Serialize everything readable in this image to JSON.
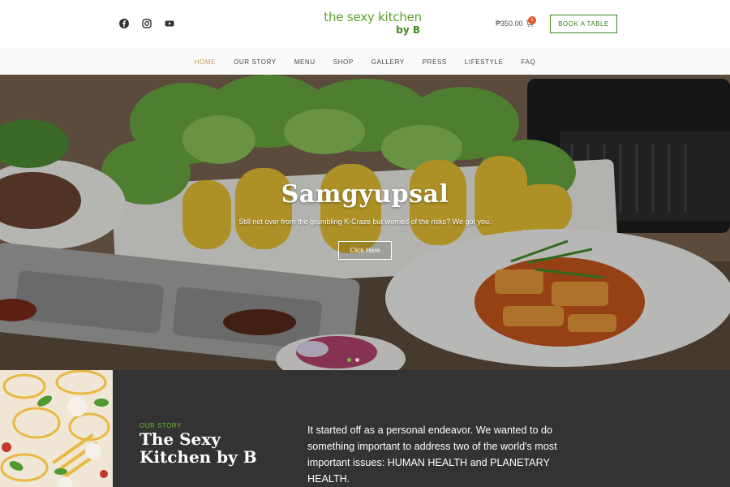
{
  "header": {
    "social": [
      "facebook-icon",
      "instagram-icon",
      "youtube-icon"
    ],
    "logo_line1": "the sexy kitchen",
    "logo_line2": "by B",
    "cart_total": "₱350.00",
    "cart_count": "1",
    "book_button": "BOOK A TABLE"
  },
  "nav": {
    "items": [
      "HOME",
      "OUR STORY",
      "MENU",
      "SHOP",
      "GALLERY",
      "PRESS",
      "LIFESTYLE",
      "FAQ"
    ],
    "active": "HOME"
  },
  "hero": {
    "title": "Samgyupsal",
    "subtitle": "Still not over from the grumbling K-Craze but worried of the risks? We got you.",
    "button": "Click Here",
    "slides": 2,
    "active_slide": 1
  },
  "story": {
    "kicker": "OUR STORY",
    "title": "The Sexy Kitchen by B",
    "text": "It started off as a personal endeavor. We wanted to do something important to address two of the world's most important issues: HUMAN HEALTH and PLANETARY HEALTH."
  },
  "colors": {
    "brand_green": "#5aa02c",
    "accent_gold": "#c8975b",
    "dark_section": "#333333",
    "badge_red": "#e4572e"
  }
}
